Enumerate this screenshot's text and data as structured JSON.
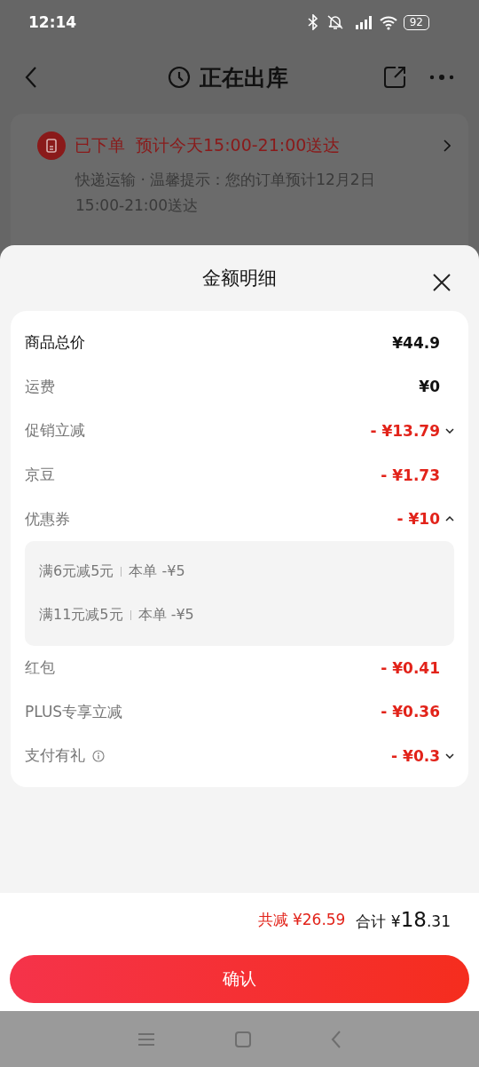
{
  "status_bar": {
    "time": "12:14",
    "battery": "92"
  },
  "header": {
    "title": "正在出库"
  },
  "order_card": {
    "status": "已下单",
    "eta": "预计今天15:00-21:00送达",
    "note": "快递运输 · 温馨提示：您的订单预计12月2日15:00-21:00送达"
  },
  "sheet": {
    "title": "金额明细",
    "rows": [
      {
        "label": "商品总价",
        "value": "¥44.9",
        "kind": "total",
        "info": false
      },
      {
        "label": "运费",
        "value": "¥0",
        "kind": "normal",
        "info": false
      },
      {
        "label": "促销立减",
        "value": "- ¥13.79",
        "kind": "discount",
        "expanded": false,
        "info": false
      },
      {
        "label": "京豆",
        "value": "- ¥1.73",
        "kind": "discount",
        "info": false
      },
      {
        "label": "优惠券",
        "value": "- ¥10",
        "kind": "discount",
        "expanded": true,
        "info": false,
        "details": [
          {
            "rule": "满6元减5元",
            "amount": "本单 -¥5"
          },
          {
            "rule": "满11元减5元",
            "amount": "本单 -¥5"
          }
        ]
      },
      {
        "label": "红包",
        "value": "- ¥0.41",
        "kind": "discount",
        "info": false
      },
      {
        "label": "PLUS专享立减",
        "value": "- ¥0.36",
        "kind": "discount",
        "info": false
      },
      {
        "label": "支付有礼",
        "value": "- ¥0.3",
        "kind": "discount",
        "expanded": false,
        "info": true
      }
    ]
  },
  "summary": {
    "saved_label": "共减",
    "saved_value": "¥26.59",
    "total_label": "合计",
    "total_currency": "¥",
    "total_integer": "18",
    "total_fraction": ".31"
  },
  "confirm_button": "确认"
}
